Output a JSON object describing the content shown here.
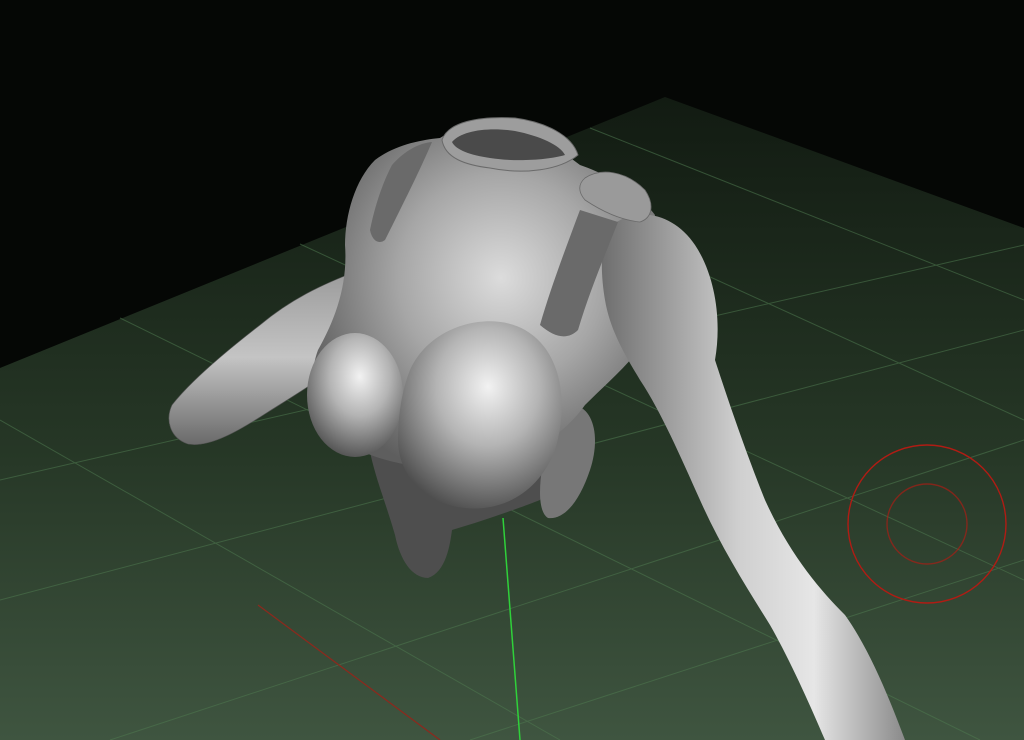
{
  "viewport": {
    "background_color": "#050705",
    "floor_color_near": "#3f5540",
    "floor_color_far": "#121b12",
    "grid_line_color": "#4f7a50"
  },
  "axes": {
    "x_axis_color": "#8a2a1e",
    "y_axis_color": "#2fd13a"
  },
  "model": {
    "mesh_color": "#a8a8a8",
    "mesh_shadow_color": "#5c5c5c",
    "mesh_highlight_color": "#eeeeee"
  },
  "brush_cursor": {
    "color": "#b01c14",
    "icon": "brush-cursor-icon"
  }
}
